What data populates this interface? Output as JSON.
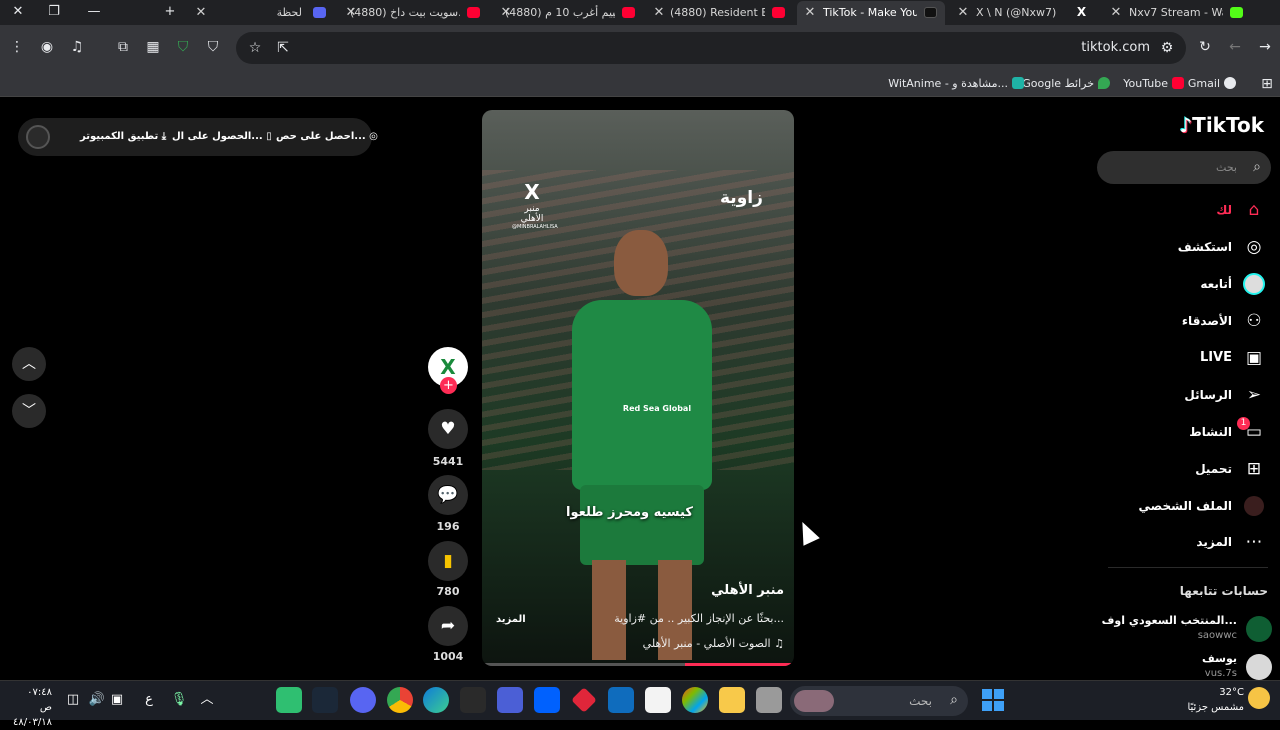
{
  "browser": {
    "tabs": [
      {
        "title": "لحظة",
        "icon": "discord-icon",
        "active": false
      },
      {
        "title": "(4880) سويت بيت داخ...",
        "icon": "youtube-icon",
        "active": false
      },
      {
        "title": "(4880) تقييم أغرب 10 م...",
        "icon": "youtube-icon",
        "active": false
      },
      {
        "title": "(4880) Resident Evil 7",
        "icon": "youtube-icon",
        "active": false
      },
      {
        "title": "TikTok - Make Your",
        "icon": "tiktok-icon",
        "active": true
      },
      {
        "title": "X \\ N (@Nxw7)",
        "icon": "x-icon",
        "active": false
      },
      {
        "title": "Nxv7 Stream - Watch",
        "icon": "kick-icon",
        "active": false
      }
    ],
    "url": "tiktok.com",
    "bookmarks": [
      {
        "label": "Gmail",
        "color": "#e8eaed"
      },
      {
        "label": "YouTube",
        "color": "#ff0033"
      },
      {
        "label": "Google خرائط",
        "color": "#34a853"
      },
      {
        "label": "WitAnime - مشاهدة و...",
        "color": "#1fb3a6"
      }
    ]
  },
  "promo": {
    "desktop_app": "تطبيق الكمبيوتر",
    "get_app": "الحصول على ال...",
    "get_coins": "احصل على حص..."
  },
  "tiktok": {
    "logo": "TikTok",
    "search_placeholder": "بحث",
    "menu": [
      {
        "label": "لك",
        "icon": "home-icon",
        "active": true
      },
      {
        "label": "استكشف",
        "icon": "compass-icon",
        "active": false
      },
      {
        "label": "أتابعه",
        "icon": "following-icon",
        "active": false
      },
      {
        "label": "الأصدقاء",
        "icon": "friends-icon",
        "active": false
      },
      {
        "label": "LIVE",
        "icon": "live-icon",
        "active": false
      },
      {
        "label": "الرسائل",
        "icon": "messages-icon",
        "active": false
      },
      {
        "label": "النشاط",
        "icon": "activity-icon",
        "active": false,
        "badge": "1"
      },
      {
        "label": "تحميل",
        "icon": "upload-icon",
        "active": false
      },
      {
        "label": "الملف الشخصي",
        "icon": "profile-icon",
        "active": false
      },
      {
        "label": "المزيد",
        "icon": "more-icon",
        "active": false
      }
    ],
    "following_title": "حسابات تتابعها",
    "following": [
      {
        "name": "المنتخب السعودي اوف...",
        "username": "saowwc",
        "color": "#0f5e33"
      },
      {
        "name": "يوسف",
        "username": "vus.7s",
        "color": "#d9d9d9"
      }
    ]
  },
  "video": {
    "channel_logo": "منبر الأهلي",
    "channel_logo_handle": "@MINBRALAHLISA",
    "brand_watermark": "زاوية",
    "sponsor": "Red Sea Global",
    "caption_overlay": "كيسيه ومحرز طلعوا",
    "author": "منبر الأهلي",
    "description": "بحثًا عن الإنجاز الكبير .. من #زاوية...",
    "more": "المزيد",
    "music": "الصوت الأصلي - منبر الأهلي",
    "progress": 0.35,
    "likes": "5441",
    "comments": "196",
    "saves": "780",
    "shares": "1004"
  },
  "taskbar": {
    "time": "٠٧:٤٨ ص",
    "date": "٤٨/٠٣/١٨",
    "lang": "ع",
    "search_placeholder": "بحث",
    "weather_temp": "32°C",
    "weather_desc": "مشمس جزئيًا",
    "weather_badge": "1"
  }
}
